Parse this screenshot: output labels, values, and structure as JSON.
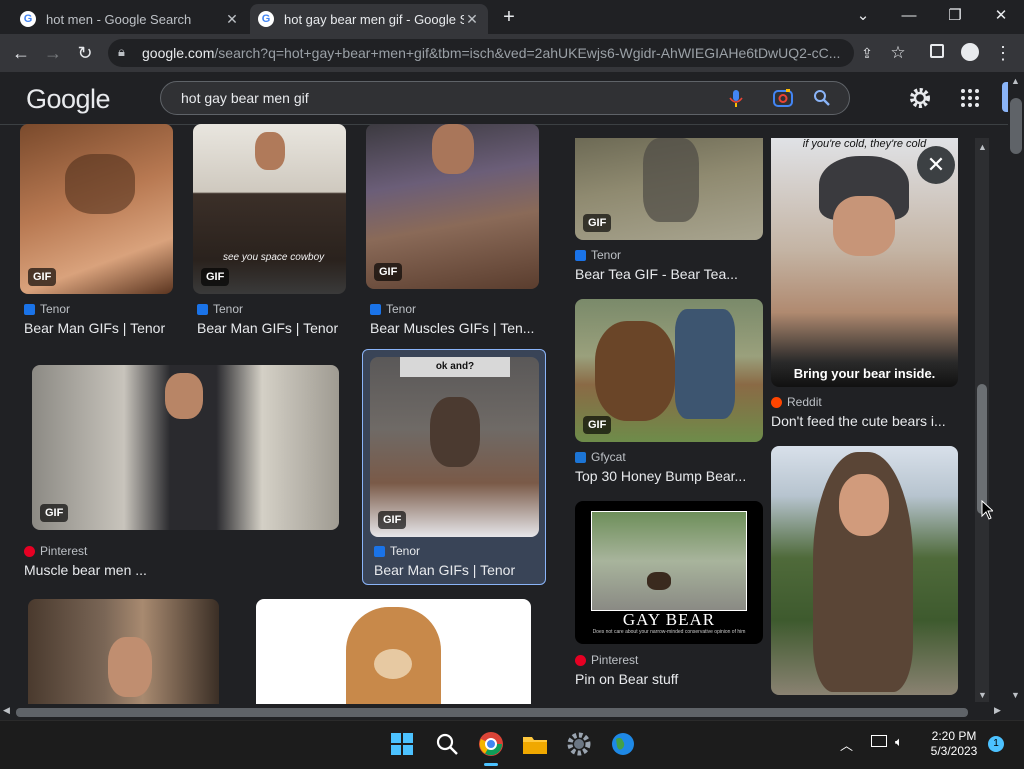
{
  "browser": {
    "tabs": [
      {
        "title": "hot men - Google Search",
        "close": "✕"
      },
      {
        "title": "hot gay bear men gif - Google Search",
        "close": "✕"
      }
    ],
    "new_tab": "+",
    "url_host": "google.com",
    "url_rest": "/search?q=hot+gay+bear+men+gif&tbm=isch&ved=2ahUKEwjs6-Wgidr-AhWIEGIAHe6tDwUQ2-cC..."
  },
  "google": {
    "logo": "Google",
    "query": "hot gay bear men gif"
  },
  "results": [
    {
      "source": "Tenor",
      "title": "Bear Man GIFs | Tenor",
      "badge": "GIF"
    },
    {
      "source": "Tenor",
      "title": "Bear Man GIFs | Tenor",
      "badge": "GIF",
      "overlay": "see you space cowboy"
    },
    {
      "source": "Tenor",
      "title": "Bear Muscles GIFs | Ten...",
      "badge": "GIF"
    },
    {
      "source": "Pinterest",
      "title": "Muscle bear men ...",
      "badge": "GIF"
    },
    {
      "source": "Tenor",
      "title": "Bear Man GIFs | Tenor",
      "badge": "GIF",
      "overlay": "ok and?"
    }
  ],
  "panel": {
    "col1": [
      {
        "source": "Tenor",
        "title": "Bear Tea GIF - Bear Tea...",
        "badge": "GIF"
      },
      {
        "source": "Gfycat",
        "title": "Top 30 Honey Bump Bear...",
        "badge": "GIF"
      },
      {
        "source": "Pinterest",
        "title": "Pin on Bear stuff",
        "overlay": "GAY BEAR",
        "overlay_small": "Does not care about your narrow-minded conservative opinion of him"
      }
    ],
    "col2": [
      {
        "source": "Reddit",
        "title": "Don't feed the cute bears i...",
        "overlay": "Bring your bear inside.",
        "top_text": "if you're cold, they're cold"
      }
    ],
    "close": "✕"
  },
  "taskbar": {
    "time": "2:20 PM",
    "date": "5/3/2023",
    "notification_count": "1"
  },
  "colors": {
    "accent": "#8ab4f8",
    "background": "#202124"
  }
}
